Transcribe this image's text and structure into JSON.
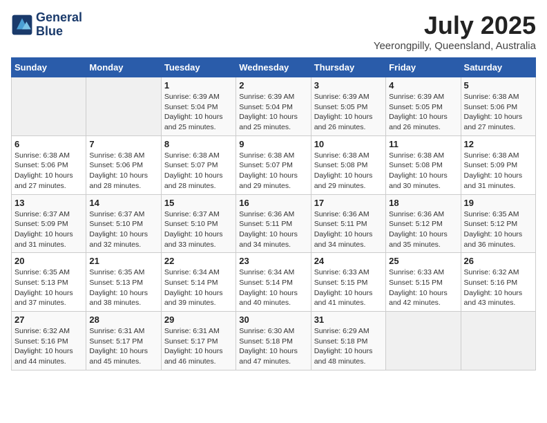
{
  "header": {
    "logo_line1": "General",
    "logo_line2": "Blue",
    "month_year": "July 2025",
    "location": "Yeerongpilly, Queensland, Australia"
  },
  "days_of_week": [
    "Sunday",
    "Monday",
    "Tuesday",
    "Wednesday",
    "Thursday",
    "Friday",
    "Saturday"
  ],
  "weeks": [
    [
      {
        "day": "",
        "detail": ""
      },
      {
        "day": "",
        "detail": ""
      },
      {
        "day": "1",
        "detail": "Sunrise: 6:39 AM\nSunset: 5:04 PM\nDaylight: 10 hours\nand 25 minutes."
      },
      {
        "day": "2",
        "detail": "Sunrise: 6:39 AM\nSunset: 5:04 PM\nDaylight: 10 hours\nand 25 minutes."
      },
      {
        "day": "3",
        "detail": "Sunrise: 6:39 AM\nSunset: 5:05 PM\nDaylight: 10 hours\nand 26 minutes."
      },
      {
        "day": "4",
        "detail": "Sunrise: 6:39 AM\nSunset: 5:05 PM\nDaylight: 10 hours\nand 26 minutes."
      },
      {
        "day": "5",
        "detail": "Sunrise: 6:38 AM\nSunset: 5:06 PM\nDaylight: 10 hours\nand 27 minutes."
      }
    ],
    [
      {
        "day": "6",
        "detail": "Sunrise: 6:38 AM\nSunset: 5:06 PM\nDaylight: 10 hours\nand 27 minutes."
      },
      {
        "day": "7",
        "detail": "Sunrise: 6:38 AM\nSunset: 5:06 PM\nDaylight: 10 hours\nand 28 minutes."
      },
      {
        "day": "8",
        "detail": "Sunrise: 6:38 AM\nSunset: 5:07 PM\nDaylight: 10 hours\nand 28 minutes."
      },
      {
        "day": "9",
        "detail": "Sunrise: 6:38 AM\nSunset: 5:07 PM\nDaylight: 10 hours\nand 29 minutes."
      },
      {
        "day": "10",
        "detail": "Sunrise: 6:38 AM\nSunset: 5:08 PM\nDaylight: 10 hours\nand 29 minutes."
      },
      {
        "day": "11",
        "detail": "Sunrise: 6:38 AM\nSunset: 5:08 PM\nDaylight: 10 hours\nand 30 minutes."
      },
      {
        "day": "12",
        "detail": "Sunrise: 6:38 AM\nSunset: 5:09 PM\nDaylight: 10 hours\nand 31 minutes."
      }
    ],
    [
      {
        "day": "13",
        "detail": "Sunrise: 6:37 AM\nSunset: 5:09 PM\nDaylight: 10 hours\nand 31 minutes."
      },
      {
        "day": "14",
        "detail": "Sunrise: 6:37 AM\nSunset: 5:10 PM\nDaylight: 10 hours\nand 32 minutes."
      },
      {
        "day": "15",
        "detail": "Sunrise: 6:37 AM\nSunset: 5:10 PM\nDaylight: 10 hours\nand 33 minutes."
      },
      {
        "day": "16",
        "detail": "Sunrise: 6:36 AM\nSunset: 5:11 PM\nDaylight: 10 hours\nand 34 minutes."
      },
      {
        "day": "17",
        "detail": "Sunrise: 6:36 AM\nSunset: 5:11 PM\nDaylight: 10 hours\nand 34 minutes."
      },
      {
        "day": "18",
        "detail": "Sunrise: 6:36 AM\nSunset: 5:12 PM\nDaylight: 10 hours\nand 35 minutes."
      },
      {
        "day": "19",
        "detail": "Sunrise: 6:35 AM\nSunset: 5:12 PM\nDaylight: 10 hours\nand 36 minutes."
      }
    ],
    [
      {
        "day": "20",
        "detail": "Sunrise: 6:35 AM\nSunset: 5:13 PM\nDaylight: 10 hours\nand 37 minutes."
      },
      {
        "day": "21",
        "detail": "Sunrise: 6:35 AM\nSunset: 5:13 PM\nDaylight: 10 hours\nand 38 minutes."
      },
      {
        "day": "22",
        "detail": "Sunrise: 6:34 AM\nSunset: 5:14 PM\nDaylight: 10 hours\nand 39 minutes."
      },
      {
        "day": "23",
        "detail": "Sunrise: 6:34 AM\nSunset: 5:14 PM\nDaylight: 10 hours\nand 40 minutes."
      },
      {
        "day": "24",
        "detail": "Sunrise: 6:33 AM\nSunset: 5:15 PM\nDaylight: 10 hours\nand 41 minutes."
      },
      {
        "day": "25",
        "detail": "Sunrise: 6:33 AM\nSunset: 5:15 PM\nDaylight: 10 hours\nand 42 minutes."
      },
      {
        "day": "26",
        "detail": "Sunrise: 6:32 AM\nSunset: 5:16 PM\nDaylight: 10 hours\nand 43 minutes."
      }
    ],
    [
      {
        "day": "27",
        "detail": "Sunrise: 6:32 AM\nSunset: 5:16 PM\nDaylight: 10 hours\nand 44 minutes."
      },
      {
        "day": "28",
        "detail": "Sunrise: 6:31 AM\nSunset: 5:17 PM\nDaylight: 10 hours\nand 45 minutes."
      },
      {
        "day": "29",
        "detail": "Sunrise: 6:31 AM\nSunset: 5:17 PM\nDaylight: 10 hours\nand 46 minutes."
      },
      {
        "day": "30",
        "detail": "Sunrise: 6:30 AM\nSunset: 5:18 PM\nDaylight: 10 hours\nand 47 minutes."
      },
      {
        "day": "31",
        "detail": "Sunrise: 6:29 AM\nSunset: 5:18 PM\nDaylight: 10 hours\nand 48 minutes."
      },
      {
        "day": "",
        "detail": ""
      },
      {
        "day": "",
        "detail": ""
      }
    ]
  ]
}
